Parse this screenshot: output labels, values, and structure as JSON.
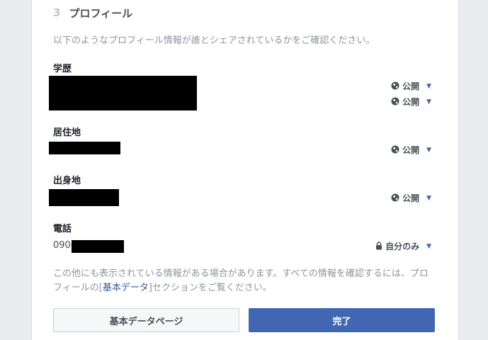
{
  "step": {
    "number": "3",
    "title": "プロフィール"
  },
  "intro": "以下のようなプロフィール情報が誰とシェアされているかをご確認ください。",
  "sections": {
    "education": {
      "label": "学歴",
      "privacy": [
        "公開",
        "公開"
      ]
    },
    "residence": {
      "label": "居住地",
      "privacy": "公開"
    },
    "hometown": {
      "label": "出身地",
      "privacy": "公開"
    },
    "phone": {
      "label": "電話",
      "prefix": "090-",
      "privacy": "自分のみ"
    }
  },
  "note": {
    "text_before": "この他にも表示されている情報がある場合があります。すべての情報を確認するには、プロフィールの[",
    "link": "基本データ",
    "text_after": "]セクションをご覧ください。"
  },
  "buttons": {
    "basic_data": "基本データページ",
    "done": "完了"
  },
  "icons": {
    "public": "globe-icon",
    "only_me": "lock-icon",
    "dropdown": "caret-down-icon"
  },
  "colors": {
    "primary": "#4267b2",
    "link": "#365899",
    "muted": "#90949c"
  }
}
